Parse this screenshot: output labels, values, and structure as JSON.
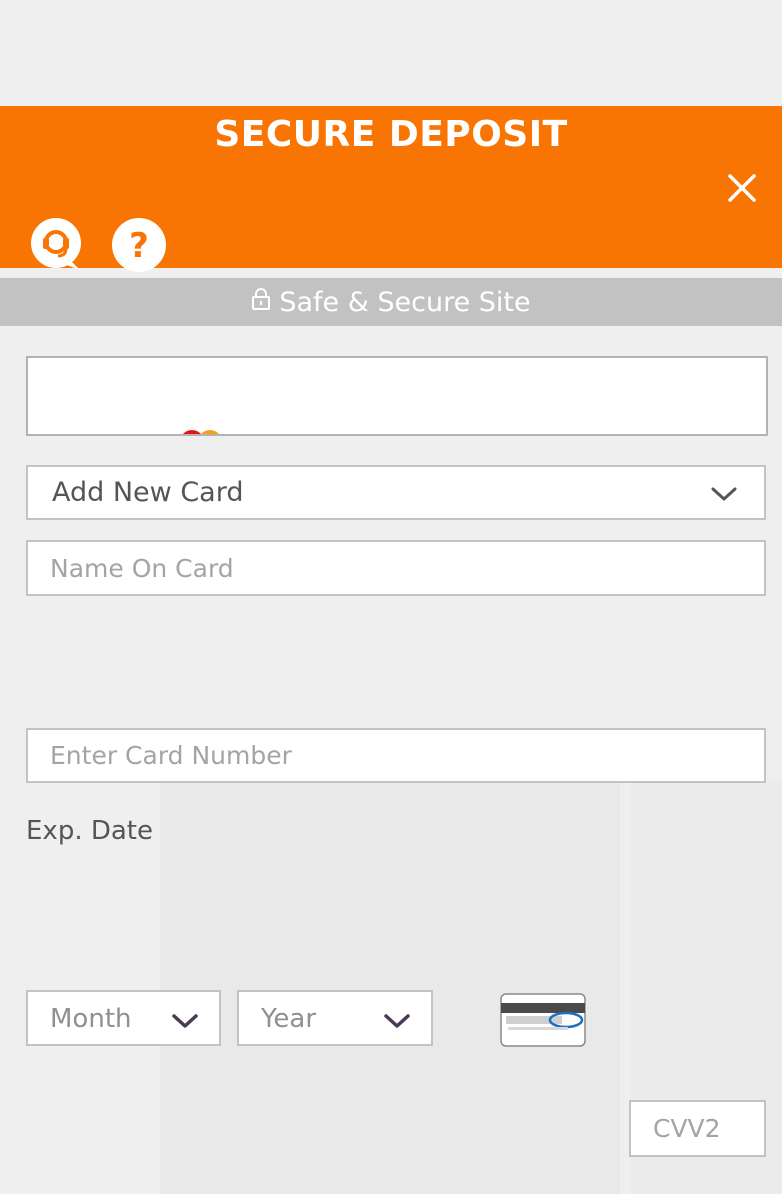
{
  "header": {
    "title": "SECURE DEPOSIT",
    "close_icon": "close-icon",
    "support_icon": "headset-icon",
    "help_icon": "question-icon"
  },
  "secure_bar": {
    "icon": "lock-icon",
    "text": "Safe & Secure Site"
  },
  "card_select": {
    "value": "Add New Card"
  },
  "form": {
    "name_placeholder": "Name On Card",
    "number_placeholder": "Enter Card Number",
    "exp_label": "Exp. Date",
    "month_value": "Month",
    "year_value": "Year",
    "cvv_placeholder": "CVV2"
  },
  "colors": {
    "accent": "#f97503",
    "secure_bar": "#c2c2c2"
  }
}
